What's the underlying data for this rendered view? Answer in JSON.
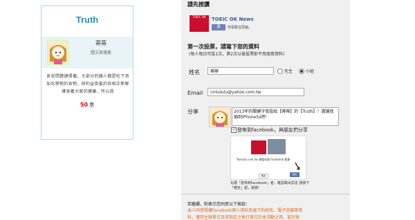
{
  "card": {
    "title": "Truth",
    "name": "蒂蒂",
    "dept": "圖文部落客",
    "description": "食安問題捷環播，大部分的國人都是吃下添加化學物的食物，排利益掛羞的良相正新鮮確食著大家的健康，所以我",
    "votes_number": "50",
    "votes_unit": "票"
  },
  "panel": {
    "step1_label": "請先按讚",
    "fb_page_logo": "TOEIC OK",
    "fb_page_name": "TOEIC OK News",
    "fb_like_button": "讚",
    "fb_like_text": "你喜歡這頁面。",
    "section_heading": "第一次投票，請寫下您的資料",
    "section_note": "(每人每日可投1次，第2次以後投票即不用填寫資料)",
    "name_label": "姓名",
    "name_value": "蒂蒂",
    "radio_mr": "先生",
    "radio_ms": "小姐",
    "email_label": "Email",
    "email_value": "cinlululu@yahoo.com.tw",
    "share_label": "分享",
    "share_text": "2013年的關健字我投給【蒂蒂】的【Truth】！請讓我抽到iPhone5s吧！",
    "share_checkbox_label": "發佈到facebook，與朋友們分享",
    "preview_site": "Toeicok.com.tw 想要存取 Facebook 個資",
    "preview_cancel": "略過",
    "preview_ok": "確定",
    "preview_caption": "勾選「發佈到facebook」者，確認跳出訊息 請按下「確定」鈕，謝謝!",
    "terms_heading": "若繼續，則表示您同意以下條款：",
    "terms_line1": "本人同意授權Facebook個人資料及留下的姓名、電子信箱等資",
    "terms_line2": "料，僅用主辦單位及其指定之執行單位於本活動之用，甚於辦"
  }
}
